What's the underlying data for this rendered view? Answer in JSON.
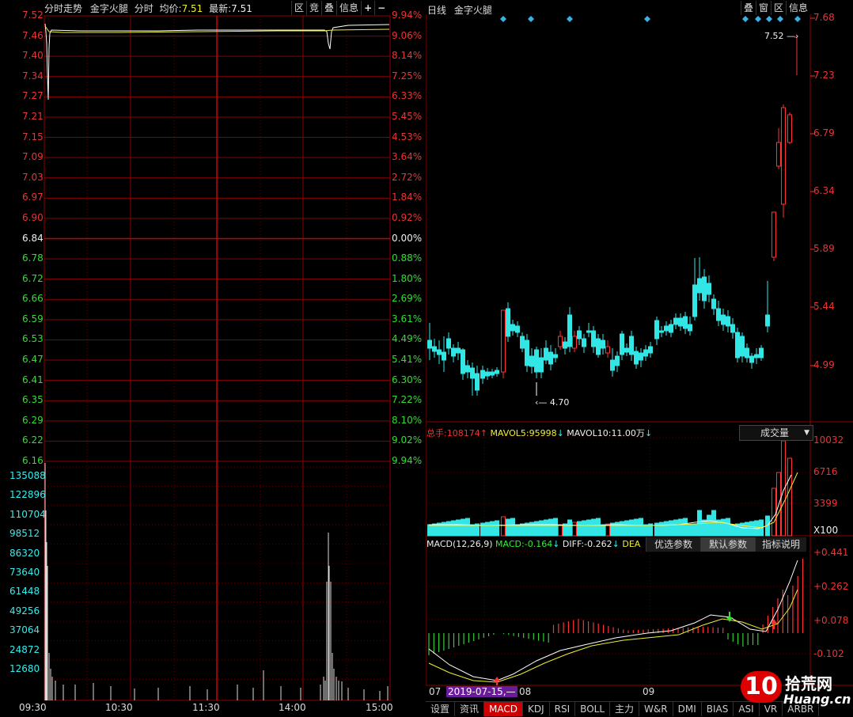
{
  "left": {
    "header": {
      "title": "分时走势",
      "stock": "金字火腿",
      "mode": "分时",
      "avg_label": "均价:",
      "avg_value": "7.51",
      "last_label": "最新:",
      "last_value": "7.51"
    },
    "buttons": [
      "区",
      "竞",
      "叠",
      "信息",
      "+",
      "−"
    ],
    "price_ticks": [
      "7.52",
      "7.46",
      "7.40",
      "7.34",
      "7.27",
      "7.21",
      "7.15",
      "7.09",
      "7.03",
      "6.97",
      "6.90",
      "6.84",
      "6.78",
      "6.72",
      "6.66",
      "6.59",
      "6.53",
      "6.47",
      "6.41",
      "6.35",
      "6.29",
      "6.22",
      "6.16"
    ],
    "pct_ticks": [
      "9.94%",
      "9.06%",
      "8.14%",
      "7.25%",
      "6.33%",
      "5.45%",
      "4.53%",
      "3.64%",
      "2.72%",
      "1.84%",
      "0.92%",
      "0.00%",
      "0.88%",
      "1.80%",
      "2.69%",
      "3.61%",
      "4.49%",
      "5.41%",
      "6.30%",
      "7.22%",
      "8.10%",
      "9.02%",
      "9.94%"
    ],
    "vol_ticks": [
      "135088",
      "122896",
      "110704",
      "98512",
      "86320",
      "73640",
      "61448",
      "49256",
      "37064",
      "24872",
      "12680"
    ],
    "time_ticks": [
      "09:30",
      "10:30",
      "11:30",
      "14:00",
      "15:00"
    ]
  },
  "right": {
    "header": {
      "title": "日线",
      "stock": "金字火腿"
    },
    "buttons": [
      "叠",
      "窗",
      "区",
      "信息"
    ],
    "price_ticks": [
      "7.68",
      "7.23",
      "6.79",
      "6.34",
      "5.89",
      "5.44",
      "4.99"
    ],
    "annotation_high": "7.52",
    "annotation_low": "4.70",
    "volume": {
      "label": "总手:",
      "value": "108174",
      "mavol5_label": "MAVOL5:",
      "mavol5_value": "95998",
      "mavol10_label": "MAVOL10:",
      "mavol10_value": "11.00万",
      "dropdown": "成交量",
      "ticks": [
        "10032",
        "6716",
        "3399"
      ],
      "unit": "X100"
    },
    "macd": {
      "label": "MACD(12,26,9)",
      "macd_label": "MACD:",
      "macd_value": "-0.164",
      "diff_label": "DIFF:",
      "diff_value": "-0.262",
      "dea_label": "DEA",
      "menu": [
        "优选参数",
        "默认参数",
        "指标说明"
      ],
      "ticks": [
        "+0.441",
        "+0.262",
        "+0.078",
        "-0.102"
      ]
    },
    "date_axis": [
      "07",
      "2019-07-15,—",
      "08",
      "09"
    ],
    "tabs": [
      "设置",
      "资讯",
      "MACD",
      "KDJ",
      "RSI",
      "BOLL",
      "主力",
      "W&R",
      "DMI",
      "BIAS",
      "ASI",
      "VR",
      "ARBR"
    ],
    "active_tab": "MACD"
  },
  "watermark": {
    "logo_text": "10",
    "site_cn": "拾荒网",
    "site_en": "Huang.cn"
  },
  "colors": {
    "up": "#ff3333",
    "down": "#33e6e6",
    "grid": "#8b0000",
    "line_white": "#ffffff",
    "line_yellow": "#ffff33"
  }
}
